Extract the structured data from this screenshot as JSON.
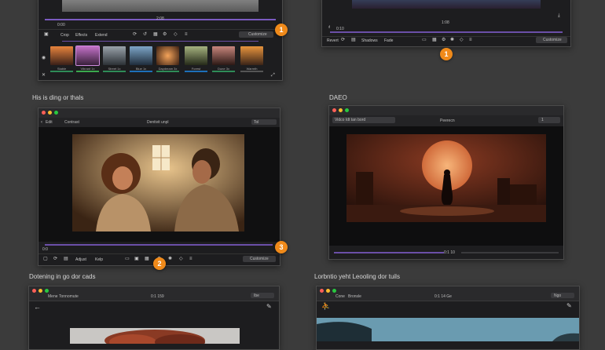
{
  "top_left": {
    "timecode": "2:08",
    "scrub_label": "0:00",
    "toolbar": [
      "Crop",
      "Effects",
      "Extend"
    ],
    "dropdown_label": "Customize",
    "badge": "1",
    "thumbs": [
      {
        "caption": "Stable",
        "bar": "#2e8b57"
      },
      {
        "caption": "Vibrant 1x",
        "bar": "#3aa84d"
      },
      {
        "caption": "Street 1x",
        "bar": "#2e8b57"
      },
      {
        "caption": "Blue 1x",
        "bar": "#1d6fb8"
      },
      {
        "caption": "Daydream 3x",
        "bar": "#2e8b57"
      },
      {
        "caption": "Forest",
        "bar": "#1d6fb8"
      },
      {
        "caption": "Dune 3x",
        "bar": "#2e8b57"
      },
      {
        "caption": "Warmth",
        "bar": "#555"
      }
    ]
  },
  "top_right": {
    "timecode": "1:08",
    "scrub_label": "0:10",
    "toolbar": [
      "Revert",
      "Shadows",
      "Fade"
    ],
    "dropdown_label": "Customize",
    "badge": "1"
  },
  "mid_left": {
    "section_title": "His is ding or thals",
    "window_title": "Dentivit unpl",
    "toolbar_left": [
      "Edit",
      "Contrast"
    ],
    "search": "Tol",
    "scrub_label": "0:0",
    "bottom_tools": [
      "Adjust",
      "Kelp"
    ],
    "dropdown_label": "Customize",
    "badges": [
      "3",
      "2"
    ]
  },
  "mid_right": {
    "section_title": "DAEO",
    "left_dropdown": "Vidco Idt tan bord",
    "window_title": "Peerecn",
    "right_value": "1",
    "timecode": "0:1 10"
  },
  "bottom_left": {
    "section_title": "Dotening in go dor cads",
    "menu": [
      "Mene",
      "Tonnomute"
    ],
    "timecode": "0:1 159",
    "right_label": "Ibe"
  },
  "bottom_right": {
    "section_title": "Lorbntio yeht Leooling dor tuils",
    "menu": [
      "Cone",
      "Bronsle"
    ],
    "timecode": "0:1 14 Ge",
    "right_label": "Ngo"
  },
  "colors": {
    "accent_purple": "#6b4fa8",
    "badge_orange": "#f08a1a",
    "close": "#ff5f57",
    "min": "#febc2e",
    "max": "#28c840"
  }
}
